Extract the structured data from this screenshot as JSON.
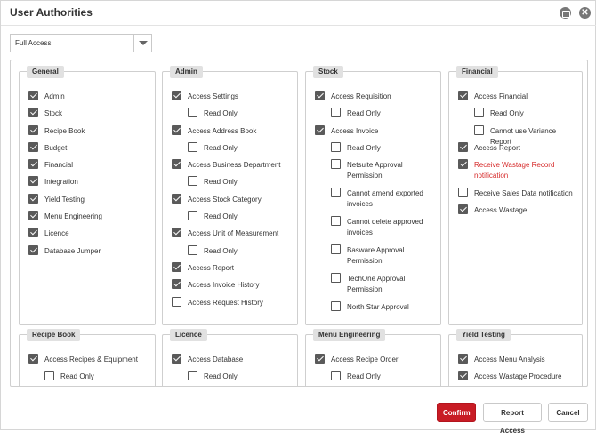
{
  "window": {
    "title": "User Authorities"
  },
  "access_select": {
    "value": "Full Access"
  },
  "panels": [
    {
      "title": "General",
      "items": [
        {
          "label": "Admin",
          "checked": true
        },
        {
          "label": "Stock",
          "checked": true
        },
        {
          "label": "Recipe Book",
          "checked": true
        },
        {
          "label": "Budget",
          "checked": true
        },
        {
          "label": "Financial",
          "checked": true
        },
        {
          "label": "Integration",
          "checked": true
        },
        {
          "label": "Yield Testing",
          "checked": true
        },
        {
          "label": "Menu Engineering",
          "checked": true
        },
        {
          "label": "Licence",
          "checked": true
        },
        {
          "label": "Database Jumper",
          "checked": true
        }
      ]
    },
    {
      "title": "Admin",
      "items": [
        {
          "label": "Access Settings",
          "checked": true
        },
        {
          "label": "Read Only",
          "checked": false,
          "indent": true
        },
        {
          "label": "Access Address Book",
          "checked": true
        },
        {
          "label": "Read Only",
          "checked": false,
          "indent": true
        },
        {
          "label": "Access Business Department",
          "checked": true
        },
        {
          "label": "Read Only",
          "checked": false,
          "indent": true
        },
        {
          "label": "Access Stock Category",
          "checked": true
        },
        {
          "label": "Read Only",
          "checked": false,
          "indent": true
        },
        {
          "label": "Access Unit of Measurement",
          "checked": true
        },
        {
          "label": "Read Only",
          "checked": false,
          "indent": true
        },
        {
          "label": "Access Report",
          "checked": true
        },
        {
          "label": "Access Invoice History",
          "checked": true
        },
        {
          "label": "Access Request History",
          "checked": false
        }
      ]
    },
    {
      "title": "Stock",
      "items": [
        {
          "label": "Access Requisition",
          "checked": true
        },
        {
          "label": "Read Only",
          "checked": false,
          "indent": true
        },
        {
          "label": "Access Invoice",
          "checked": true
        },
        {
          "label": "Read Only",
          "checked": false,
          "indent": true
        },
        {
          "label": "Netsuite Approval Permission",
          "checked": false,
          "indent": true,
          "tall": true
        },
        {
          "label": "Cannot amend exported invoices",
          "checked": false,
          "indent": true,
          "tall": true
        },
        {
          "label": "Cannot delete approved invoices",
          "checked": false,
          "indent": true,
          "tall": true
        },
        {
          "label": "Basware Approval Permission",
          "checked": false,
          "indent": true,
          "tall": true
        },
        {
          "label": "TechOne Approval Permission",
          "checked": false,
          "indent": true,
          "tall": true
        },
        {
          "label": "North Star Approval",
          "checked": false,
          "indent": true
        }
      ]
    },
    {
      "title": "Financial",
      "items": [
        {
          "label": "Access Financial",
          "checked": true
        },
        {
          "label": "Read Only",
          "checked": false,
          "indent": true
        },
        {
          "label": "Cannot use Variance Report",
          "checked": false,
          "indent": true
        },
        {
          "label": "Access Report",
          "checked": true
        },
        {
          "label": "Receive Wastage Record notification",
          "checked": true,
          "red": true,
          "tall": true
        },
        {
          "label": "Receive Sales Data notification",
          "checked": false
        },
        {
          "label": "Access Wastage",
          "checked": true
        }
      ]
    },
    {
      "title": "Recipe Book",
      "items": [
        {
          "label": "Access Recipes & Equipment",
          "checked": true
        },
        {
          "label": "Read Only",
          "checked": false,
          "indent": true
        }
      ]
    },
    {
      "title": "Licence",
      "items": [
        {
          "label": "Access Database",
          "checked": true
        },
        {
          "label": "Read Only",
          "checked": false,
          "indent": true
        }
      ]
    },
    {
      "title": "Menu Engineering",
      "items": [
        {
          "label": "Access Recipe Order",
          "checked": true
        },
        {
          "label": "Read Only",
          "checked": false,
          "indent": true
        }
      ]
    },
    {
      "title": "Yield Testing",
      "items": [
        {
          "label": "Access Menu Analysis",
          "checked": true
        },
        {
          "label": "Access Wastage Procedure",
          "checked": true
        }
      ]
    }
  ],
  "footer": {
    "confirm_label": "Confirm",
    "report_label": "Report Access",
    "cancel_label": "Cancel"
  },
  "colors": {
    "confirm_bg": "#c81c25",
    "warning_text": "#d62a2a"
  }
}
